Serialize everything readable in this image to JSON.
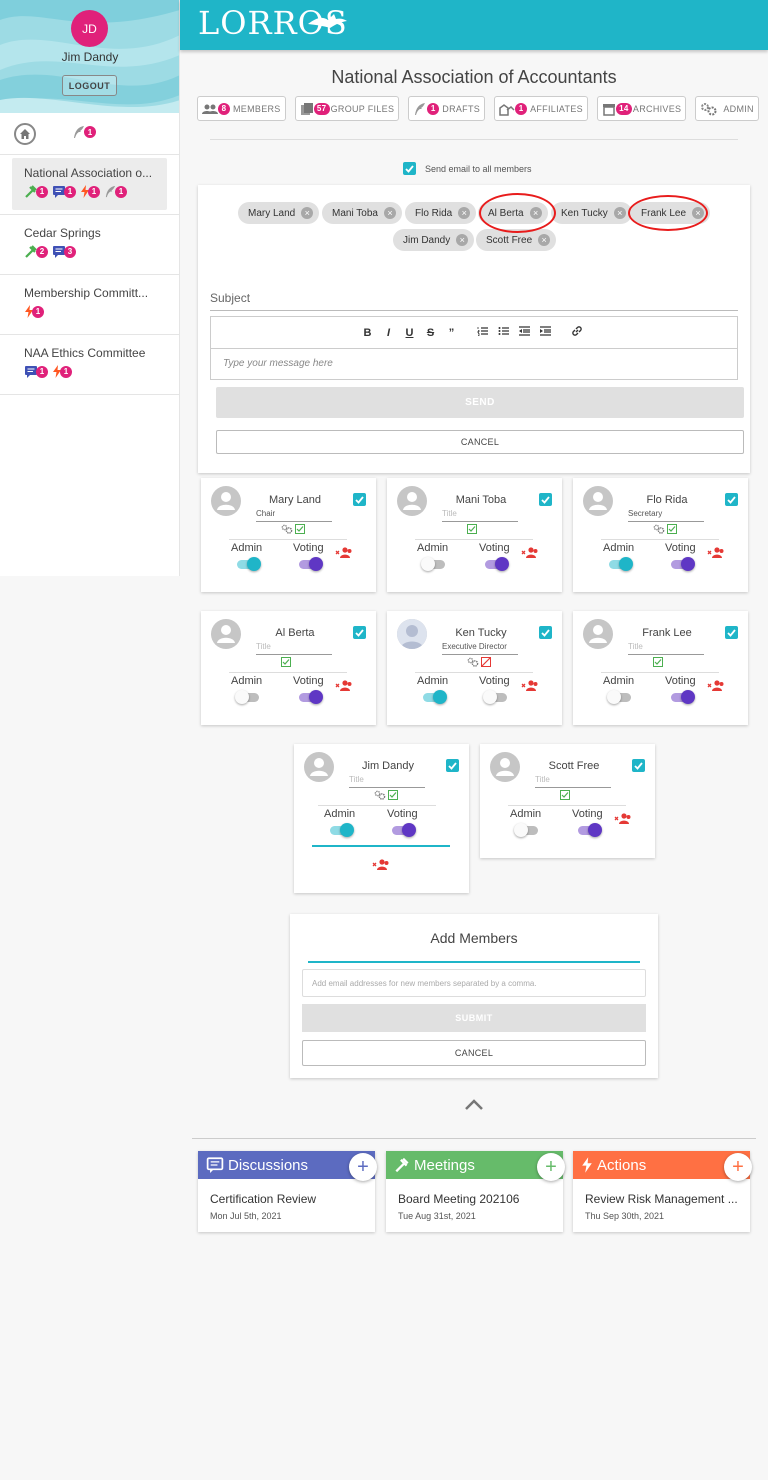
{
  "sidebar": {
    "avatar_initials": "JD",
    "user_name": "Jim Dandy",
    "logout_label": "LOGOUT",
    "drafts_badge": "1",
    "groups": [
      {
        "name": "National Association o...",
        "badges": [
          "1",
          "1",
          "1",
          "1"
        ]
      },
      {
        "name": "Cedar Springs",
        "badges": [
          "2",
          "3"
        ]
      },
      {
        "name": "Membership Committ...",
        "badges": [
          "1"
        ]
      },
      {
        "name": "NAA Ethics Committee",
        "badges": [
          "1",
          "1"
        ]
      }
    ]
  },
  "header": {
    "logo": "LORROS",
    "org_title": "National Association of Accountants",
    "tabs": [
      {
        "count": "8",
        "label": "MEMBERS",
        "icon": "members-icon"
      },
      {
        "count": "57",
        "label": "GROUP FILES",
        "icon": "files-icon"
      },
      {
        "count": "1",
        "label": "DRAFTS",
        "icon": "feather-icon"
      },
      {
        "count": "1",
        "label": "AFFILIATES",
        "icon": "affiliates-icon"
      },
      {
        "count": "14",
        "label": "ARCHIVES",
        "icon": "archive-icon"
      },
      {
        "count": "",
        "label": "ADMIN",
        "icon": "gear-icon"
      }
    ]
  },
  "composer": {
    "send_all_label": "Send email to all members",
    "recipients": [
      "Mary Land",
      "Mani Toba",
      "Flo Rida",
      "Al Berta",
      "Ken Tucky",
      "Frank Lee",
      "Jim Dandy",
      "Scott Free"
    ],
    "subject_placeholder": "Subject",
    "message_placeholder": "Type your message here",
    "send_label": "SEND",
    "cancel_label": "CANCEL"
  },
  "labels": {
    "admin": "Admin",
    "voting": "Voting"
  },
  "members": [
    {
      "name": "Mary Land",
      "title": "Chair",
      "admin": true,
      "voting": true
    },
    {
      "name": "Mani Toba",
      "title": "Title",
      "admin": false,
      "voting": true
    },
    {
      "name": "Flo Rida",
      "title": "Secretary",
      "admin": true,
      "voting": true
    },
    {
      "name": "Al Berta",
      "title": "Title",
      "admin": false,
      "voting": true
    },
    {
      "name": "Ken Tucky",
      "title": "Executive Director",
      "admin": true,
      "voting": false
    },
    {
      "name": "Frank Lee",
      "title": "Title",
      "admin": false,
      "voting": true
    },
    {
      "name": "Jim Dandy",
      "title": "Title",
      "admin": true,
      "voting": true
    },
    {
      "name": "Scott Free",
      "title": "Title",
      "admin": false,
      "voting": true
    }
  ],
  "add_members": {
    "title": "Add Members",
    "placeholder": "Add email addresses for new members separated by a comma.",
    "submit_label": "SUBMIT",
    "cancel_label": "CANCEL"
  },
  "bottom_cards": [
    {
      "header": "Discussions",
      "color": "#5c6bc0",
      "item_title": "Certification Review",
      "item_date": "Mon Jul 5th, 2021"
    },
    {
      "header": "Meetings",
      "color": "#66bb6a",
      "item_title": "Board Meeting 202106",
      "item_date": "Tue Aug 31st, 2021"
    },
    {
      "header": "Actions",
      "color": "#ff7043",
      "item_title": "Review Risk Management ...",
      "item_date": "Thu Sep 30th, 2021"
    }
  ],
  "colors": {
    "accent": "#1fb5c8",
    "badge": "#e0217a",
    "voting": "#5f37c4",
    "highlight_ring": "#e81c1c"
  }
}
